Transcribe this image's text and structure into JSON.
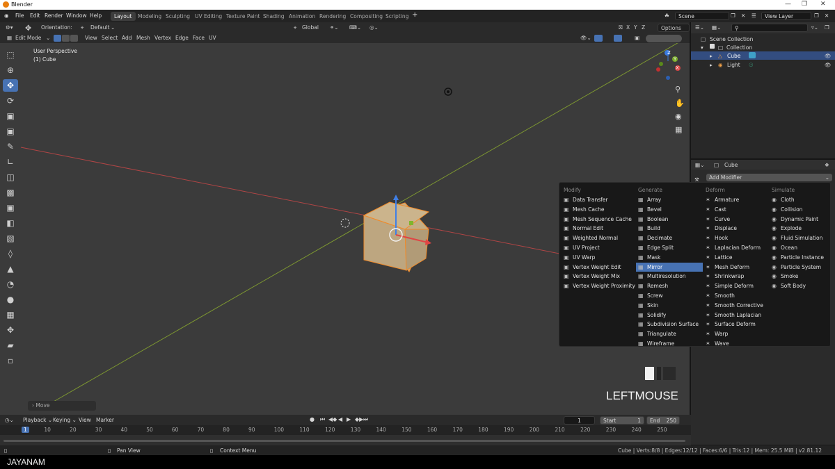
{
  "window": {
    "title": "Blender"
  },
  "topmenu": {
    "items": [
      "File",
      "Edit",
      "Render",
      "Window",
      "Help"
    ]
  },
  "workspaces": [
    "Layout",
    "Modeling",
    "Sculpting",
    "UV Editing",
    "Texture Paint",
    "Shading",
    "Animation",
    "Rendering",
    "Compositing",
    "Scripting"
  ],
  "active_workspace": "Layout",
  "scene": {
    "name": "Scene",
    "view_layer": "View Layer"
  },
  "toolheader": {
    "orientation_label": "Orientation:",
    "orientation_value": "Default",
    "transform": "Global",
    "options": "Options"
  },
  "editheader": {
    "mode": "Edit Mode",
    "menus": [
      "View",
      "Select",
      "Add",
      "Mesh",
      "Vertex",
      "Edge",
      "Face",
      "UV"
    ]
  },
  "axes": {
    "x": "X",
    "y": "Y",
    "z": "Z"
  },
  "viewport": {
    "overlay_title": "User Perspective",
    "overlay_object": "(1) Cube",
    "last_op": "Move",
    "key_label": "LEFTMOUSE"
  },
  "outliner": {
    "root": "Scene Collection",
    "items": [
      "Collection",
      "Cube",
      "Light"
    ]
  },
  "properties": {
    "object": "Cube",
    "add_modifier": "Add Modifier"
  },
  "modifier_menu": {
    "columns": [
      {
        "heading": "Modify",
        "items": [
          "Data Transfer",
          "Mesh Cache",
          "Mesh Sequence Cache",
          "Normal Edit",
          "Weighted Normal",
          "UV Project",
          "UV Warp",
          "Vertex Weight Edit",
          "Vertex Weight Mix",
          "Vertex Weight Proximity"
        ]
      },
      {
        "heading": "Generate",
        "items": [
          "Array",
          "Bevel",
          "Boolean",
          "Build",
          "Decimate",
          "Edge Split",
          "Mask",
          "Mirror",
          "Multiresolution",
          "Remesh",
          "Screw",
          "Skin",
          "Solidify",
          "Subdivision Surface",
          "Triangulate",
          "Wireframe"
        ]
      },
      {
        "heading": "Deform",
        "items": [
          "Armature",
          "Cast",
          "Curve",
          "Displace",
          "Hook",
          "Laplacian Deform",
          "Lattice",
          "Mesh Deform",
          "Shrinkwrap",
          "Simple Deform",
          "Smooth",
          "Smooth Corrective",
          "Smooth Laplacian",
          "Surface Deform",
          "Warp",
          "Wave"
        ]
      },
      {
        "heading": "Simulate",
        "items": [
          "Cloth",
          "Collision",
          "Dynamic Paint",
          "Explode",
          "Fluid Simulation",
          "Ocean",
          "Particle Instance",
          "Particle System",
          "Smoke",
          "Soft Body"
        ]
      }
    ],
    "highlighted": "Mirror"
  },
  "timeline": {
    "menus": [
      "Playback",
      "Keying",
      "View",
      "Marker"
    ],
    "current_frame": "1",
    "start_label": "Start",
    "start": "1",
    "end_label": "End",
    "end": "250",
    "ticks": [
      "1",
      "10",
      "20",
      "30",
      "40",
      "50",
      "60",
      "70",
      "80",
      "90",
      "100",
      "110",
      "120",
      "130",
      "140",
      "150",
      "160",
      "170",
      "180",
      "190",
      "200",
      "210",
      "220",
      "230",
      "240",
      "250"
    ]
  },
  "statusbar": {
    "left": "Pan View",
    "mid": "Context Menu",
    "right": "Cube | Verts:8/8 | Edges:12/12 | Faces:6/6 | Tris:12 | Mem: 25.5 MiB | v2.81.12"
  },
  "watermark": "JAYANAM",
  "colors": {
    "accent": "#4772b3",
    "viewport_bg": "#3b3b3b",
    "cube_face": "#c4ad85",
    "x_axis": "#c84545",
    "y_axis": "#7a9a2a"
  }
}
